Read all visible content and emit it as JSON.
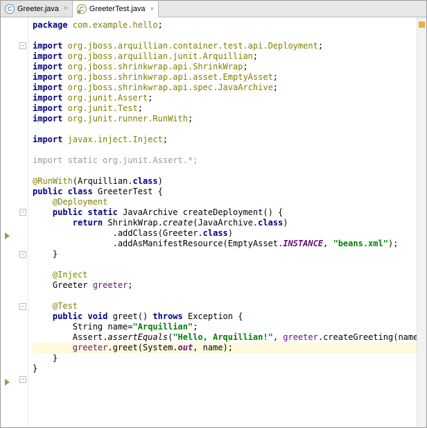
{
  "tabs": [
    {
      "label": "Greeter.java",
      "iconLetter": "C",
      "active": false
    },
    {
      "label": "GreeterTest.java",
      "iconLetter": "J",
      "active": true
    }
  ],
  "code": {
    "l1_pkg_kw": "package ",
    "l1_pkg": "com.example.hello",
    "semi": ";",
    "imp_kw": "import ",
    "imp1": "org.jboss.arquillian.container.test.api.Deployment",
    "imp2": "org.jboss.arquillian.junit.Arquillian",
    "imp3": "org.jboss.shrinkwrap.api.ShrinkWrap",
    "imp4": "org.jboss.shrinkwrap.api.asset.EmptyAsset",
    "imp5": "org.jboss.shrinkwrap.api.spec.JavaArchive",
    "imp6": "org.junit.Assert",
    "imp7": "org.junit.Test",
    "imp8": "org.junit.runner.RunWith",
    "imp9": "javax.inject.Inject",
    "imp_static": "import static org.junit.Assert.*;",
    "ann_runwith": "@RunWith",
    "runwith_arg_open": "(Arquillian.",
    "kw_class": "class",
    "close_paren": ")",
    "kw_public": "public ",
    "kw_class_decl": "class ",
    "class_name": "GreeterTest ",
    "brace_open": "{",
    "ann_deployment": "@Deployment",
    "kw_static": "static ",
    "ret_type": "JavaArchive ",
    "method_createDeployment": "createDeployment() ",
    "kw_return": "return ",
    "sw_create_call": "ShrinkWrap.",
    "create_m": "create",
    "create_args_open": "(JavaArchive.",
    "addClass_call": ".addClass(Greeter.",
    "addManifest_call": ".addAsManifestResource(EmptyAsset.",
    "instance_const": "INSTANCE",
    "comma_sp": ", ",
    "str_beansxml": "\"beans.xml\"",
    "close_paren_semi": ");",
    "brace_close": "}",
    "ann_inject": "@Inject",
    "greeter_type": "Greeter ",
    "greeter_field": "greeter",
    "ann_test": "@Test",
    "kw_void": "void ",
    "method_greet": "greet() ",
    "kw_throws": "throws ",
    "exc_type": "Exception ",
    "string_type": "String ",
    "name_var": "name",
    "eq": "=",
    "str_arquillian": "\"Arquillian\"",
    "assert_call": "Assert.",
    "assertEquals_m": "assertEquals",
    "open_paren": "(",
    "str_hello": "\"Hello, Arquillian!\"",
    "greeter_ref": "greeter",
    "createGreeting_call": ".createGreeting(name));",
    "greet_call_pre": ".greet(System.",
    "out_const": "out",
    "comma_name_close": ", name);"
  }
}
